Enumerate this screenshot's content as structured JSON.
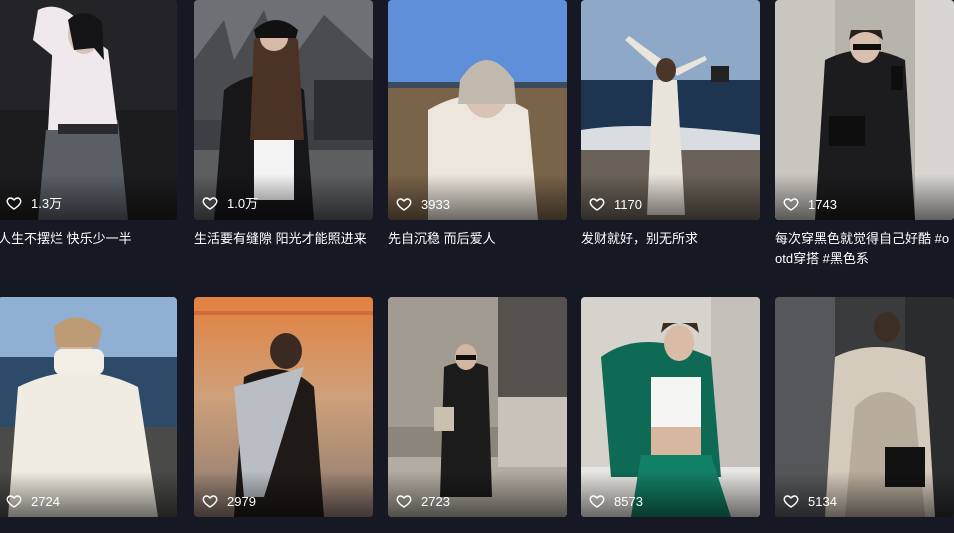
{
  "cards": [
    {
      "likes": "1.3万",
      "caption": "人生不摆烂 快乐少一半"
    },
    {
      "likes": "1.0万",
      "caption": "生活要有缝隙 阳光才能照进来"
    },
    {
      "likes": "3933",
      "caption": "先自沉稳 而后爱人"
    },
    {
      "likes": "1170",
      "caption": "发财就好，别无所求"
    },
    {
      "likes": "1743",
      "caption": "每次穿黑色就觉得自己好酷 #ootd穿搭 #黑色系"
    },
    {
      "likes": "2724",
      "caption": ""
    },
    {
      "likes": "2979",
      "caption": ""
    },
    {
      "likes": "2723",
      "caption": ""
    },
    {
      "likes": "8573",
      "caption": ""
    },
    {
      "likes": "5134",
      "caption": ""
    }
  ],
  "colors": {
    "background": "#161823",
    "text": "#ffffff"
  },
  "icons": {
    "like": "heart-outline-icon"
  }
}
